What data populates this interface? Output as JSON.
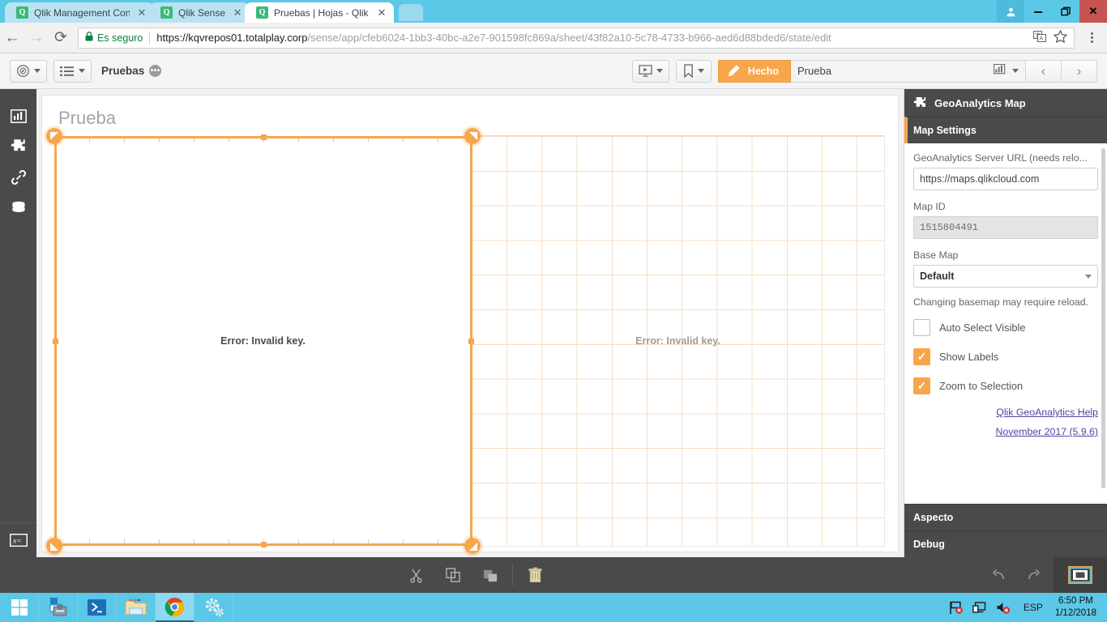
{
  "browser": {
    "tabs": [
      {
        "title": "Qlik Management Conso",
        "favicon": "qlik-icon",
        "active": false
      },
      {
        "title": "Qlik Sense",
        "favicon": "qlik-icon",
        "active": false
      },
      {
        "title": "Pruebas | Hojas - Qlik Se",
        "favicon": "qlik-icon",
        "active": true
      }
    ],
    "window_controls": {
      "user": "user-icon",
      "minimize": "—",
      "restore": "❐",
      "close": "✕"
    },
    "nav": {
      "back": "←",
      "forward": "→",
      "reload": "⟳"
    },
    "omnibox": {
      "lock_icon": "lock-icon",
      "security_text": "Es seguro",
      "url_host": "https://kqvrepos01.totalplay.corp",
      "url_path": "/sense/app/cfeb6024-1bb3-40bc-a2e7-901598fc869a/sheet/43f82a10-5c78-4733-b966-aed6d88bded6/state/edit",
      "translate_icon": "translate-icon",
      "bookmark_icon": "star-icon"
    },
    "menu_icon": "kebab-menu-icon"
  },
  "qlik_toolbar": {
    "nav_menu_icon": "compass-icon",
    "sheet_list_icon": "list-icon",
    "app_name": "Pruebas",
    "app_badge": "•••",
    "story_icon": "story-icon",
    "bookmark_icon": "bookmark-icon",
    "done_label": "Hecho",
    "edit_icon": "pencil-icon",
    "sheet_name": "Prueba",
    "sheet_thumb_icon": "chart-thumb-icon",
    "prev_label": "‹",
    "next_label": "›"
  },
  "sidebar": {
    "items": [
      {
        "name": "charts",
        "icon": "bar-chart-icon"
      },
      {
        "name": "custom-objects",
        "icon": "puzzle-piece-icon"
      },
      {
        "name": "master-items",
        "icon": "link-icon"
      },
      {
        "name": "fields",
        "icon": "database-icon"
      }
    ],
    "bottom": {
      "name": "expression",
      "icon": "expression-icon",
      "glyph": "x="
    }
  },
  "canvas": {
    "sheet_title": "Prueba",
    "objects": [
      {
        "name": "geoanalytics-map-selected",
        "error_text": "Error: Invalid key.",
        "selected": true
      },
      {
        "name": "geoanalytics-map-secondary",
        "error_text": "Error: Invalid key.",
        "selected": false
      }
    ]
  },
  "property_panel": {
    "title": "GeoAnalytics Map",
    "title_icon": "puzzle-piece-icon",
    "sections": [
      {
        "label": "Map Settings",
        "active": true
      },
      {
        "label": "Aspecto",
        "active": false
      },
      {
        "label": "Debug",
        "active": false
      }
    ],
    "fields": {
      "server_url_label": "GeoAnalytics Server URL (needs relo...",
      "server_url_value": "https://maps.qlikcloud.com",
      "map_id_label": "Map ID",
      "map_id_value": "1515804491",
      "base_map_label": "Base Map",
      "base_map_value": "Default",
      "basemap_note": "Changing basemap may require reload."
    },
    "checkboxes": [
      {
        "label": "Auto Select Visible",
        "checked": false
      },
      {
        "label": "Show Labels",
        "checked": true
      },
      {
        "label": "Zoom to Selection",
        "checked": true
      }
    ],
    "links": [
      {
        "label": "Qlik GeoAnalytics Help"
      },
      {
        "label": "November 2017 (5.9.6)"
      }
    ],
    "accent_color": "#f7a64b"
  },
  "edit_bar": {
    "actions": [
      {
        "name": "cut",
        "icon": "scissors-icon"
      },
      {
        "name": "copy",
        "icon": "copy-icon"
      },
      {
        "name": "paste",
        "icon": "paste-icon"
      },
      {
        "name": "delete",
        "icon": "trash-icon"
      }
    ],
    "undo": {
      "name": "undo",
      "icon": "undo-arrow-icon"
    },
    "redo": {
      "name": "redo",
      "icon": "redo-arrow-icon"
    },
    "preview": {
      "name": "sheet-preview",
      "icon": "layout-preview-icon"
    }
  },
  "taskbar": {
    "items": [
      {
        "name": "start",
        "icon": "windows-logo-icon",
        "active": false
      },
      {
        "name": "server-manager",
        "icon": "server-manager-icon",
        "active": false
      },
      {
        "name": "powershell",
        "icon": "powershell-icon",
        "active": false
      },
      {
        "name": "file-explorer",
        "icon": "folder-icon",
        "active": false
      },
      {
        "name": "google-chrome",
        "icon": "chrome-icon",
        "active": true
      },
      {
        "name": "settings",
        "icon": "gears-icon",
        "active": false
      }
    ],
    "tray": {
      "icons": [
        {
          "name": "network-flag",
          "icon": "flag-error-icon"
        },
        {
          "name": "remote-desktop",
          "icon": "monitor-icon"
        },
        {
          "name": "volume",
          "icon": "speaker-muted-icon"
        }
      ],
      "language": "ESP",
      "time": "6:50 PM",
      "date": "1/12/2018"
    }
  }
}
